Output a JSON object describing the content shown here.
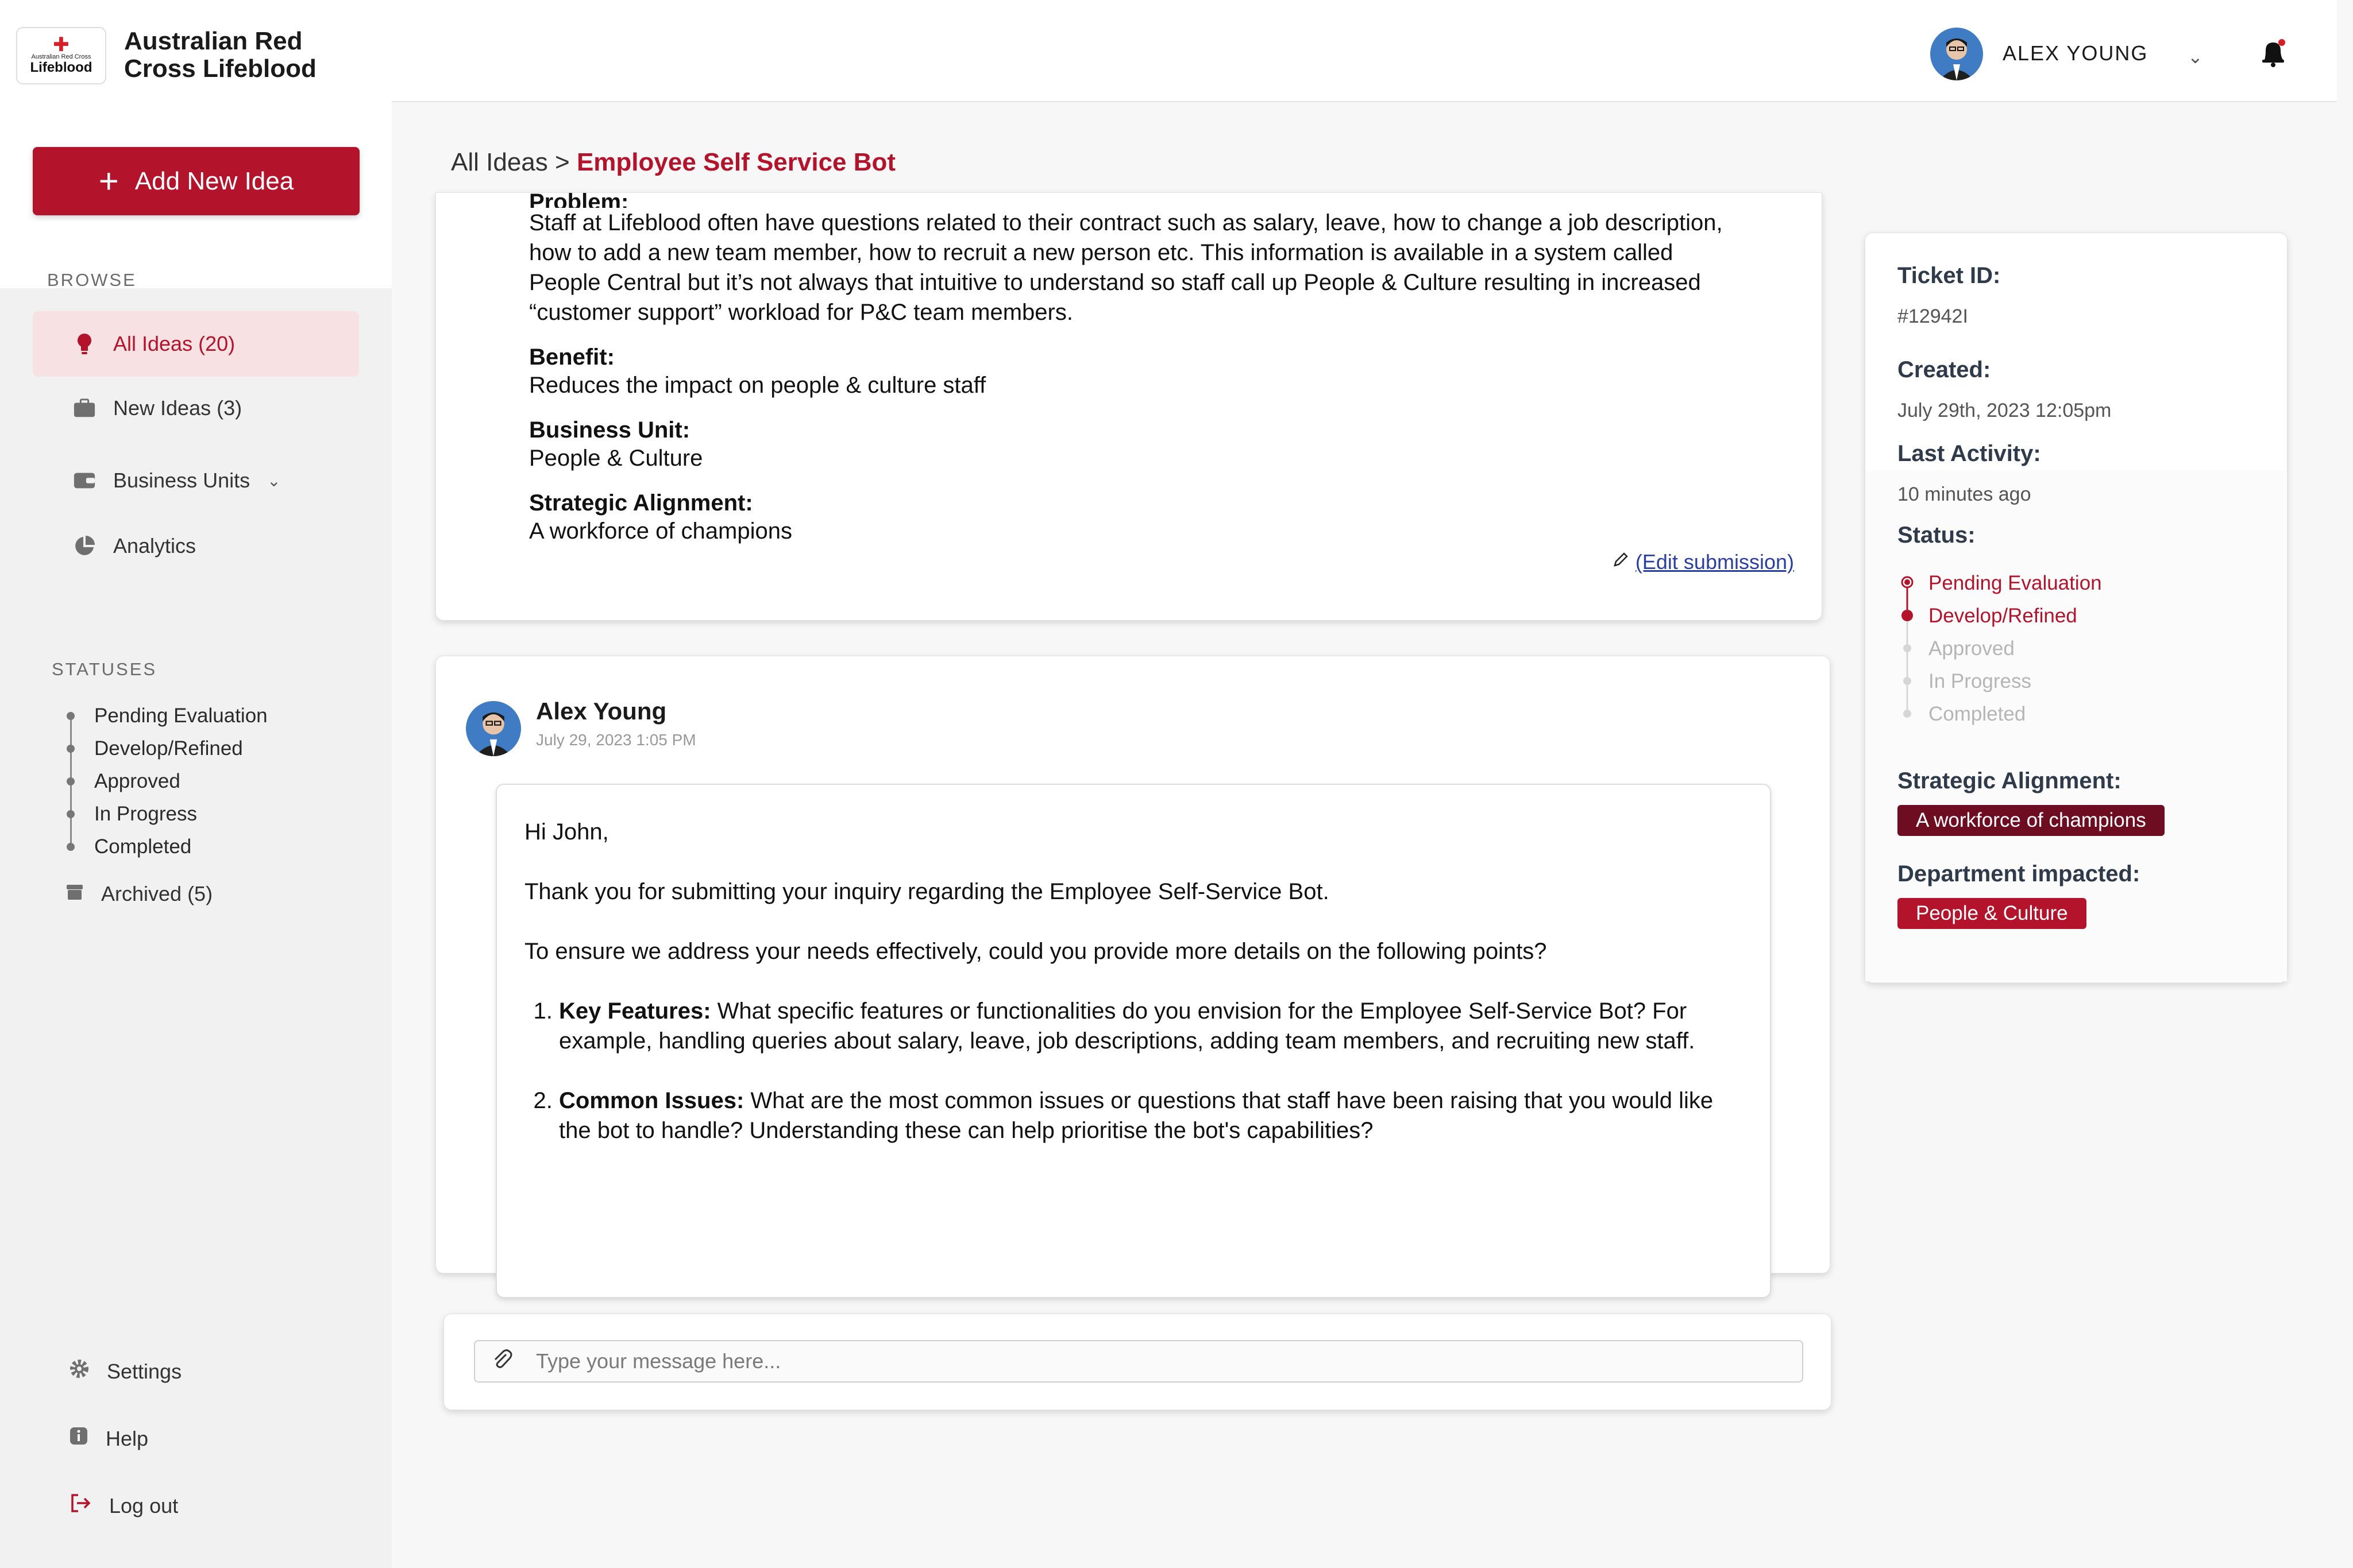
{
  "org": {
    "name": "Australian Red Cross Lifeblood",
    "logo_small": "Australian Red Cross",
    "logo_word": "Lifeblood"
  },
  "sidebar": {
    "add_button": "Add New Idea",
    "browse_label": "BROWSE",
    "items": [
      {
        "label": "All Ideas (20)",
        "icon": "lightbulb-icon",
        "active": true
      },
      {
        "label": "New Ideas (3)",
        "icon": "briefcase-icon"
      },
      {
        "label": "Business Units",
        "icon": "wallet-icon"
      },
      {
        "label": "Analytics",
        "icon": "pie-chart-icon"
      }
    ],
    "statuses_label": "STATUSES",
    "statuses": [
      "Pending Evaluation",
      "Develop/Refined",
      "Approved",
      "In Progress",
      "Completed"
    ],
    "archived": "Archived (5)",
    "settings": "Settings",
    "help": "Help",
    "logout": "Log out"
  },
  "header": {
    "user_name": "ALEX YOUNG"
  },
  "breadcrumb": {
    "root": "All Ideas",
    "separator": ">",
    "current": "Employee Self Service Bot"
  },
  "idea": {
    "problem_label": "Problem:",
    "problem_text": "Staff at Lifeblood often have questions related to their contract such as salary, leave, how to change a job description, how to add a new team member, how to recruit a new person etc. This information is available in a system called People Central but it’s not always that intuitive to understand so staff call up People & Culture resulting in increased “customer support” workload for P&C team members.",
    "benefit_label": "Benefit:",
    "benefit_text": "Reduces the impact on people & culture staff",
    "unit_label": "Business Unit:",
    "unit_text": "People & Culture",
    "alignment_label": "Strategic Alignment:",
    "alignment_text": "A workforce of champions",
    "edit_link": "(Edit submission)"
  },
  "comment": {
    "author": "Alex Young",
    "date": "July 29, 2023 1:05 PM",
    "greeting": "Hi John,",
    "para1": "Thank you for submitting your inquiry regarding the Employee Self-Service Bot.",
    "para2": "To ensure we address your needs effectively, could you provide more details on the following points?",
    "points": [
      {
        "title": "Key Features:",
        "text": " What specific features or functionalities do you envision for the Employee Self-Service Bot? For example, handling queries about salary, leave, job descriptions, adding team members, and recruiting new staff."
      },
      {
        "title": "Common Issues:",
        "text": " What are the most common issues or questions that staff have been raising that you would like the bot to handle? Understanding these can help prioritise the bot's capabilities?"
      }
    ]
  },
  "compose": {
    "placeholder": "Type your message here..."
  },
  "details": {
    "ticket_label": "Ticket ID:",
    "ticket_value": "#12942I",
    "created_label": "Created:",
    "created_value": "July 29th, 2023 12:05pm",
    "activity_label": "Last Activity:",
    "activity_value": "10 minutes ago",
    "status_label": "Status:",
    "statuses": [
      {
        "label": "Pending Evaluation",
        "active": true
      },
      {
        "label": "Develop/Refined",
        "active": true
      },
      {
        "label": "Approved",
        "active": false
      },
      {
        "label": "In Progress",
        "active": false
      },
      {
        "label": "Completed",
        "active": false
      }
    ],
    "alignment_label": "Strategic Alignment:",
    "alignment_tag": "A workforce of champions",
    "department_label": "Department impacted:",
    "department_tag": "People & Culture"
  },
  "colors": {
    "brand": "#b3132b",
    "brand_dark": "#6e0d22",
    "active_bg": "#f8e1e3"
  }
}
